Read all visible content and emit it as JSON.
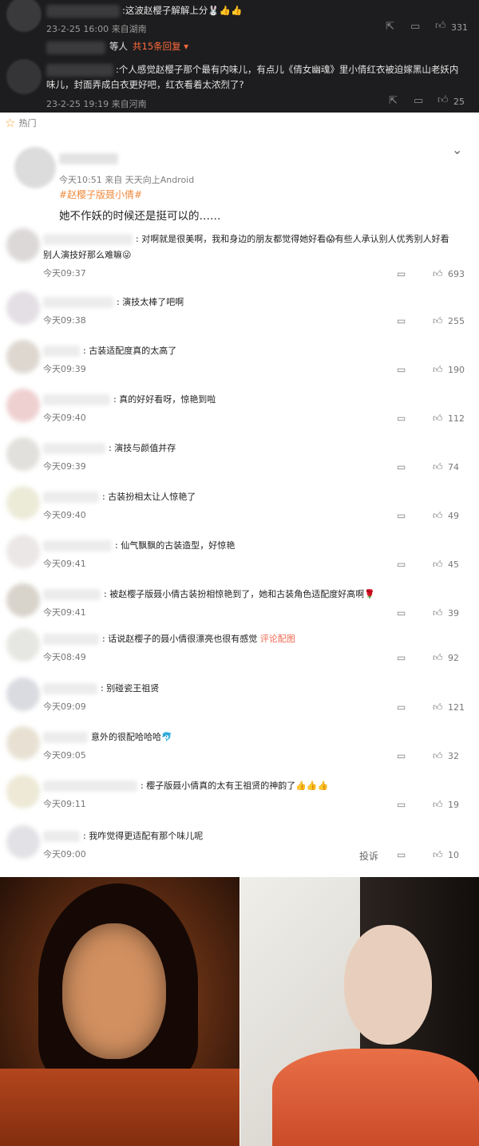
{
  "dark_block": {
    "first": {
      "text": ":这波赵樱子解解上分🐰👍👍",
      "date": "23-2-25 16:00",
      "location": "来自湖南",
      "like_count": "331"
    },
    "second": {
      "suffix": "等人",
      "replies": "共15条回复 ▾",
      "text_line1": ":个人感觉赵樱子那个最有内味儿，有点儿《倩女幽魂》里小倩红衣被迫嫁黑山老妖内",
      "text_line2": "味儿，封面弄成白衣更好吧，红衣看着太浓烈了?",
      "date": "23-2-25 19:19",
      "location": "来自河南",
      "like_count": "25"
    }
  },
  "hot_label": "热门",
  "post": {
    "meta": "今天10:51  来自 天天向上Android",
    "tag": "#赵樱子版聂小倩#",
    "body": "她不作妖的时候还是挺可以的……"
  },
  "comments": [
    {
      "text": ":  对啊就是很美啊，我和身边的朋友都觉得她好看😱有些人承认别人优秀别人好看",
      "text2": "别人演技好那么难嘛😜",
      "time": "今天09:37",
      "likes": "693"
    },
    {
      "text": ":  演技太棒了吧啊",
      "time": "今天09:38",
      "likes": "255"
    },
    {
      "text": ":  古装适配度真的太高了",
      "time": "今天09:39",
      "likes": "190"
    },
    {
      "text": ":  真的好好看呀，惊艳到啦",
      "time": "今天09:40",
      "likes": "112"
    },
    {
      "text": ":  演技与颜值并存",
      "time": "今天09:39",
      "likes": "74"
    },
    {
      "text": ":  古装扮相太让人惊艳了",
      "time": "今天09:40",
      "likes": "49"
    },
    {
      "text": ":  仙气飘飘的古装造型，好惊艳",
      "time": "今天09:41",
      "likes": "45"
    },
    {
      "text": ":  被赵樱子版聂小倩古装扮相惊艳到了，她和古装角色适配度好高啊🌹",
      "time": "今天09:41",
      "likes": "39"
    },
    {
      "text": ":  话说赵樱子的聂小倩很漂亮也很有感觉",
      "link": "评论配图",
      "time": "今天08:49",
      "likes": "92"
    },
    {
      "text": ":  别碰瓷王祖贤",
      "time": "今天09:09",
      "likes": "121"
    },
    {
      "text": "意外的很配哈哈哈🐬",
      "time": "今天09:05",
      "likes": "32"
    },
    {
      "text": ":  樱子版聂小倩真的太有王祖贤的神韵了👍👍👍",
      "time": "今天09:11",
      "likes": "19"
    },
    {
      "text": ":  我咋觉得更适配有那个味儿呢",
      "time": "今天09:00",
      "likes": "10",
      "report": "投诉"
    }
  ],
  "icons": {
    "share": "share-icon",
    "comment": "comment-icon",
    "like": "thumbs-up-icon",
    "hot": "star-icon",
    "collapse": "chevron-down-icon"
  },
  "colors": {
    "dark_bg": "#1d1d1f",
    "link_orange": "#f08a3c",
    "hot_star": "#f7a234",
    "replies_accent": "#ff6b3d",
    "red_link": "#f06a52"
  }
}
